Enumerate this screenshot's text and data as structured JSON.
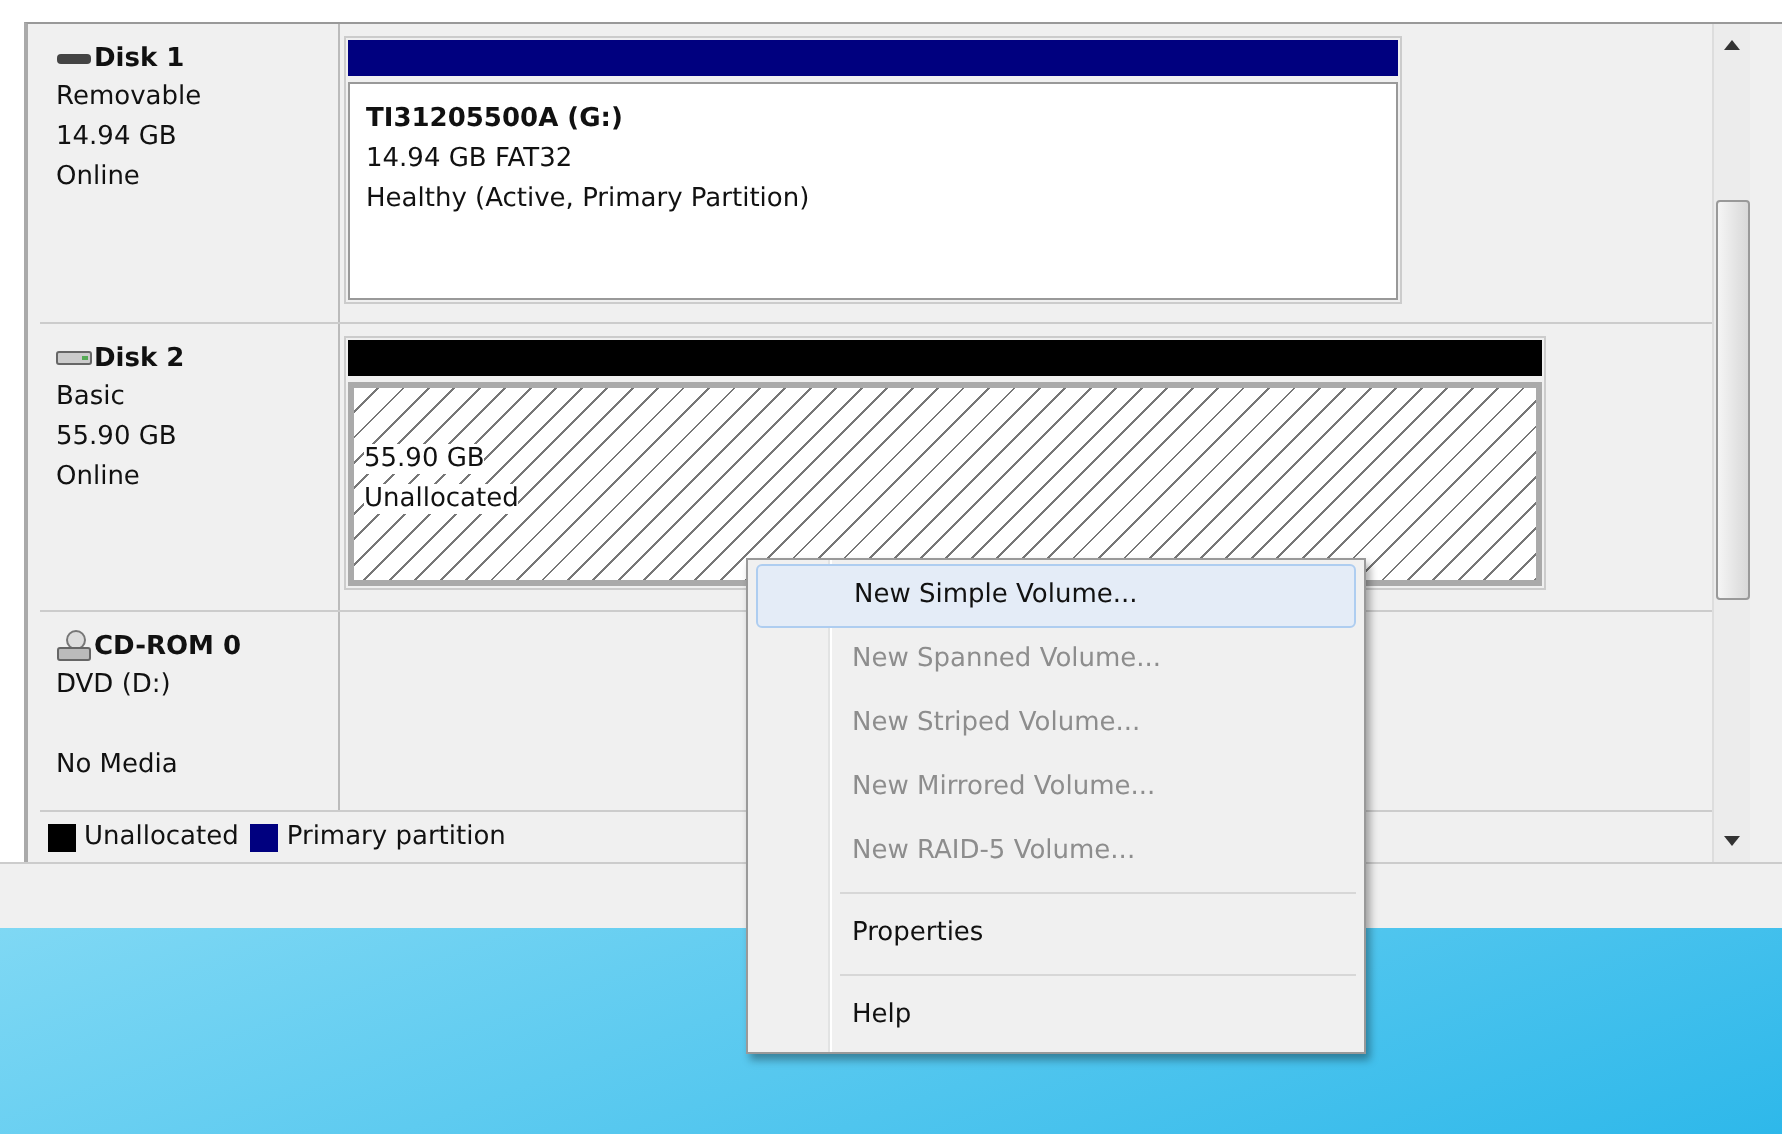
{
  "disks": [
    {
      "kind": "removable",
      "name": "Disk 1",
      "lines": [
        "Removable",
        "14.94 GB",
        "Online"
      ],
      "partition": {
        "kind": "primary",
        "title": "TI31205500A  (G:)",
        "lines": [
          "14.94 GB FAT32",
          "Healthy (Active, Primary Partition)"
        ]
      }
    },
    {
      "kind": "basic",
      "name": "Disk 2",
      "lines": [
        "Basic",
        "55.90 GB",
        "Online"
      ],
      "partition": {
        "kind": "unallocated",
        "lines": [
          "55.90 GB",
          "Unallocated"
        ]
      }
    },
    {
      "kind": "cdrom",
      "name": "CD-ROM 0",
      "lines": [
        "DVD (D:)",
        "No Media"
      ]
    }
  ],
  "legend": [
    {
      "label": "Unallocated",
      "color": "#000000"
    },
    {
      "label": "Primary partition",
      "color": "#00007f"
    }
  ],
  "context_menu": [
    [
      {
        "label": "New Simple Volume...",
        "disabled": false,
        "selected": true
      },
      {
        "label": "New Spanned Volume...",
        "disabled": true,
        "selected": false
      },
      {
        "label": "New Striped Volume...",
        "disabled": true,
        "selected": false
      },
      {
        "label": "New Mirrored Volume...",
        "disabled": true,
        "selected": false
      },
      {
        "label": "New RAID-5 Volume...",
        "disabled": true,
        "selected": false
      }
    ],
    [
      {
        "label": "Properties",
        "disabled": false,
        "selected": false
      }
    ],
    [
      {
        "label": "Help",
        "disabled": false,
        "selected": false
      }
    ]
  ]
}
